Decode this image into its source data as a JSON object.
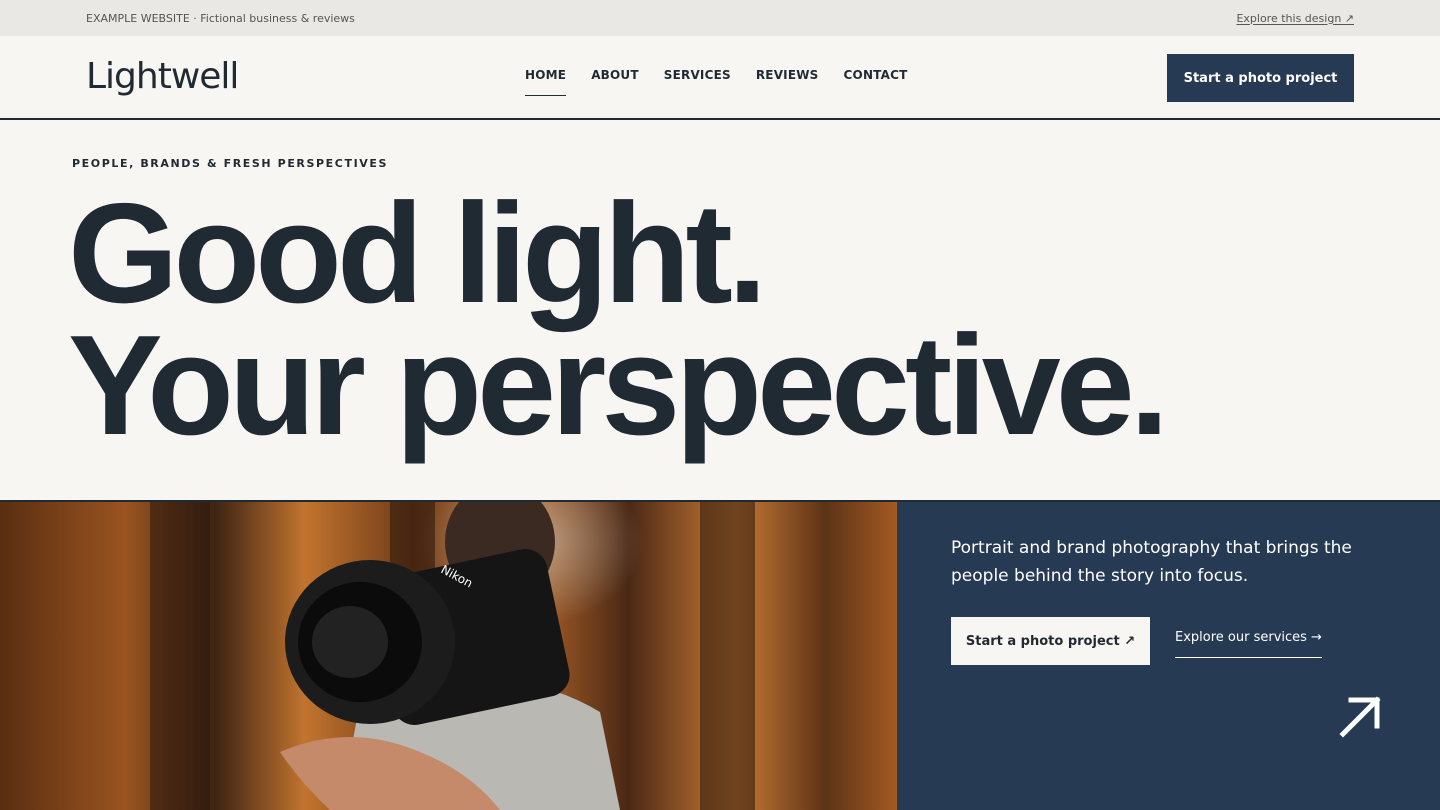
{
  "topbar": {
    "notice": "EXAMPLE WEBSITE · Fictional business & reviews",
    "explore_link": "Explore this design ↗"
  },
  "header": {
    "logo": "Lightwell",
    "nav": [
      {
        "label": "HOME",
        "active": true
      },
      {
        "label": "ABOUT",
        "active": false
      },
      {
        "label": "SERVICES",
        "active": false
      },
      {
        "label": "REVIEWS",
        "active": false
      },
      {
        "label": "CONTACT",
        "active": false
      }
    ],
    "cta_label": "Start a photo project"
  },
  "hero": {
    "eyebrow": "PEOPLE, BRANDS & FRESH PERSPECTIVES",
    "headline_line1": "Good light.",
    "headline_line2": "Your perspective."
  },
  "feature": {
    "photo_alt": "Photographer catching a floating Nikon camera in an autumn forest",
    "lead": "Portrait and brand photography that brings the people behind the story into focus.",
    "primary_button": "Start a photo project ↗",
    "secondary_link": "Explore our services →",
    "arrow_icon": "arrow-up-right-icon"
  },
  "colors": {
    "background": "#f7f6f3",
    "topbar": "#e9e8e4",
    "text": "#1f2a33",
    "accent_navy": "#263a53",
    "white": "#ffffff"
  }
}
